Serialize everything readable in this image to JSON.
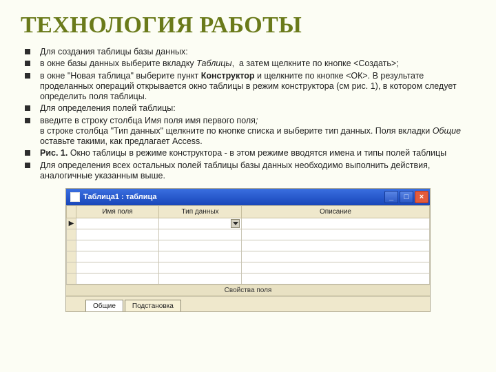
{
  "title": "ТЕХНОЛОГИЯ РАБОТЫ",
  "bullets": [
    {
      "html": "Для создания таблицы базы данных:"
    },
    {
      "html": "в окне базы данных выберите вкладку <i>Таблицы</i>,&nbsp; а затем щелкните по кнопке &lt;Создать&gt;;"
    },
    {
      "html": "в окне \"Новая таблица\" выберите пункт <b>Конструктор</b> и щелкните по кнопке &lt;ОК&gt;. В результате проделанных операций открывается окно таблицы в режим конструктора (см рис. 1), в котором следует определить поля таблицы."
    },
    {
      "html": "Для определения полей таблицы:"
    },
    {
      "html": "введите в строку столбца Имя поля имя первого поля<i>;</i><br>в строке столбца \"Тип данных\" щелкните по кнопке списка и выберите тип данных. Поля вкладки <i>Общие</i> оставьте такими, как предлагает Access."
    },
    {
      "html": "<b>Рис. 1.</b> Окно таблицы в режиме конструктора - в этом режиме вводятся имена и типы полей таблицы"
    },
    {
      "html": "Для определения всех остальных полей таблицы базы данных необходимо выполнить действия, аналогичные указанным выше."
    }
  ],
  "win": {
    "caption": "Таблица1 : таблица",
    "min": "_",
    "max": "□",
    "close": "×"
  },
  "grid": {
    "headers": [
      "Имя поля",
      "Тип данных",
      "Описание"
    ],
    "current_marker": "▶",
    "col_widths": [
      "14px",
      "110px",
      "110px",
      "auto"
    ]
  },
  "propbar": "Свойства поля",
  "tabs": {
    "front": "Общие",
    "back": "Подстановка"
  }
}
